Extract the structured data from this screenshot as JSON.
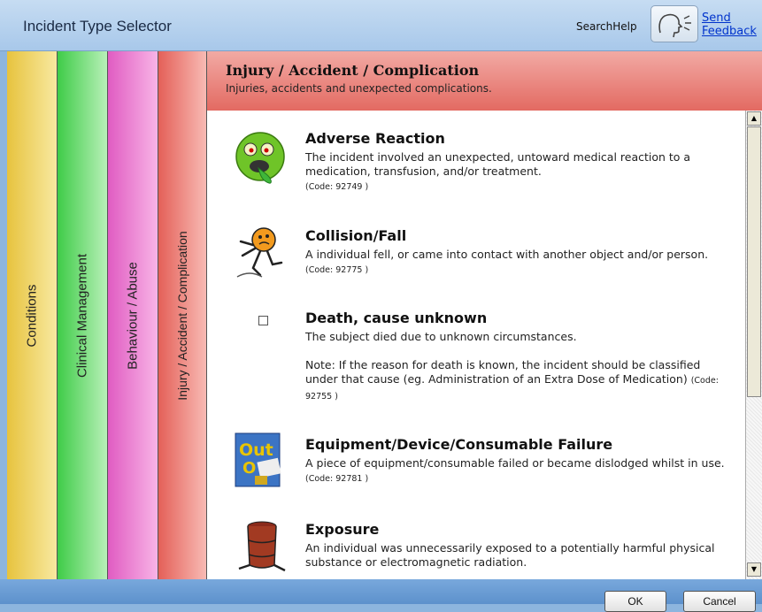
{
  "window": {
    "title": "Incident Type Selector"
  },
  "toolbar": {
    "search_help": "SearchHelp",
    "feedback_line1": "Send",
    "feedback_line2": "Feedback"
  },
  "tabs": [
    {
      "label": "Conditions",
      "color": "#e7c33e"
    },
    {
      "label": "Clinical Management",
      "color": "#3fcc48"
    },
    {
      "label": "Behaviour / Abuse",
      "color": "#e05cc2"
    },
    {
      "label": "Injury / Accident / Complication",
      "color": "#e46058",
      "active": true
    }
  ],
  "section": {
    "title": "Injury / Accident / Complication",
    "subtitle": "Injuries, accidents and unexpected complications."
  },
  "items": [
    {
      "name": "Adverse Reaction",
      "description": "The incident involved an unexpected, untoward medical reaction to a medication, transfusion, and/or treatment.",
      "code": "(Code: 92749 )",
      "icon": "sick-face-icon"
    },
    {
      "name": "Collision/Fall",
      "description": "A individual fell, or came into contact with another object and/or person.",
      "code": "(Code: 92775 )",
      "icon": "falling-figure-icon"
    },
    {
      "name": "Death, cause unknown",
      "description": "The subject died due to unknown circumstances.",
      "note": "Note: If the reason for death is known, the incident should be classified under that cause (eg. Administration of an Extra Dose of Medication)",
      "code": "(Code: 92755 )",
      "icon": "broken-image-icon"
    },
    {
      "name": "Equipment/Device/Consumable Failure",
      "description": "A piece of equipment/consumable failed or became dislodged whilst in use.",
      "code": "(Code: 92781 )",
      "icon": "out-of-order-sign-icon"
    },
    {
      "name": "Exposure",
      "description": "An individual was unnecessarily exposed to a potentially harmful physical substance or electromagnetic radiation.",
      "icon": "toxic-barrel-icon"
    }
  ],
  "buttons": {
    "ok": "OK",
    "cancel": "Cancel"
  }
}
